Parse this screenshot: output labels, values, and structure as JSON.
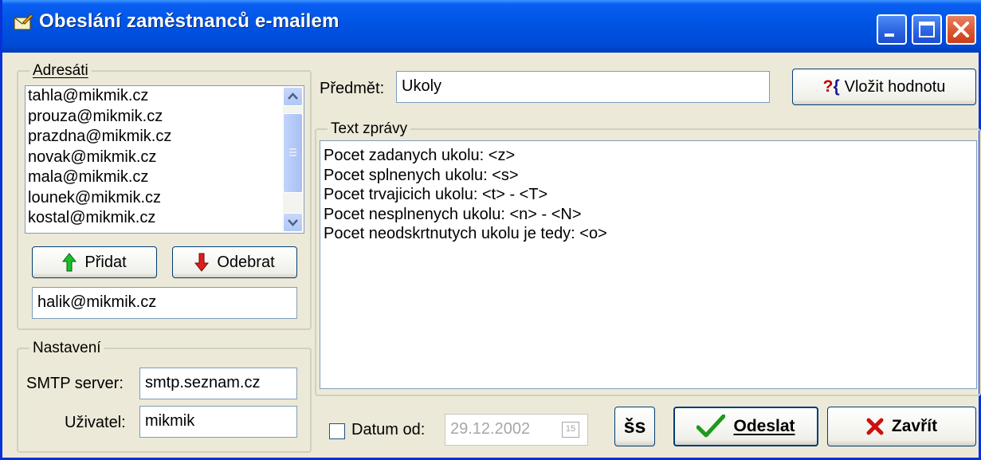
{
  "window": {
    "title": "Obeslání zaměstnanců e-mailem"
  },
  "recipients": {
    "legend": "Adresáti",
    "items": [
      "tahla@mikmik.cz",
      "prouza@mikmik.cz",
      "prazdna@mikmik.cz",
      "novak@mikmik.cz",
      "mala@mikmik.cz",
      "lounek@mikmik.cz",
      "kostal@mikmik.cz"
    ],
    "add_label": "Přidat",
    "remove_label": "Odebrat",
    "new_address": "halik@mikmik.cz"
  },
  "settings": {
    "legend": "Nastavení",
    "smtp_label": "SMTP server:",
    "smtp_value": "smtp.seznam.cz",
    "user_label": "Uživatel:",
    "user_value": "mikmik"
  },
  "message": {
    "subject_label": "Předmět:",
    "subject_value": "Ukoly",
    "insert_value_label": "Vložit hodnotu",
    "text_legend": "Text zprávy",
    "lines": [
      "Pocet zadanych ukolu: <z>",
      "Pocet splnenych ukolu: <s>",
      "Pocet trvajicich ukolu: <t> - <T>",
      "Pocet nesplnenych ukolu: <n> - <N>",
      "Pocet neodskrtnutych ukolu je tedy: <o>"
    ]
  },
  "footer": {
    "date_checkbox_label": "Datum od:",
    "date_checked": false,
    "date_value": "29.12.2002",
    "calendar_day": "15",
    "special_button": "šs",
    "send_label": "Odeslat",
    "close_label": "Zavřít"
  },
  "colors": {
    "titlebar": "#0055e5",
    "window_bg": "#ece9d8",
    "close_button": "#d9532e"
  }
}
